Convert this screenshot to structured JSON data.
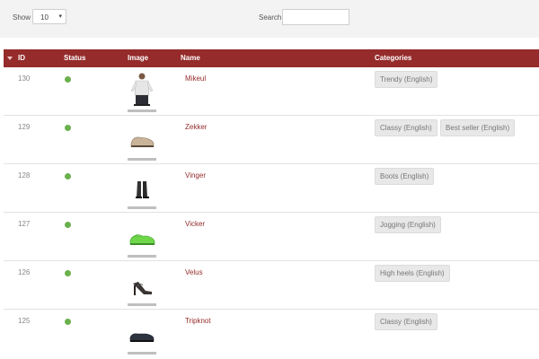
{
  "controls": {
    "show_label": "Show",
    "page_size": "10",
    "search_label": "Search:",
    "search_value": ""
  },
  "columns": {
    "id": "ID",
    "status": "Status",
    "image": "Image",
    "name": "Name",
    "categories": "Categories"
  },
  "colors": {
    "header_bg": "#952b2b",
    "name_link": "#952b2b",
    "status_active": "#6ab04c"
  },
  "rows": [
    {
      "id": "130",
      "status": "active",
      "image": "man-apparel-icon",
      "name": "Mikeul",
      "categories": [
        "Trendy (English)"
      ]
    },
    {
      "id": "129",
      "status": "active",
      "image": "beige-shoe-icon",
      "name": "Zekker",
      "categories": [
        "Classy (English)",
        "Best seller (English)"
      ]
    },
    {
      "id": "128",
      "status": "active",
      "image": "black-boots-icon",
      "name": "Vinger",
      "categories": [
        "Boots (English)"
      ]
    },
    {
      "id": "127",
      "status": "active",
      "image": "green-sneakers-icon",
      "name": "Vicker",
      "categories": [
        "Jogging (English)"
      ]
    },
    {
      "id": "126",
      "status": "active",
      "image": "high-heels-icon",
      "name": "Velus",
      "categories": [
        "High heels (English)"
      ]
    },
    {
      "id": "125",
      "status": "active",
      "image": "dark-shoes-icon",
      "name": "Tripknot",
      "categories": [
        "Classy (English)"
      ]
    }
  ]
}
